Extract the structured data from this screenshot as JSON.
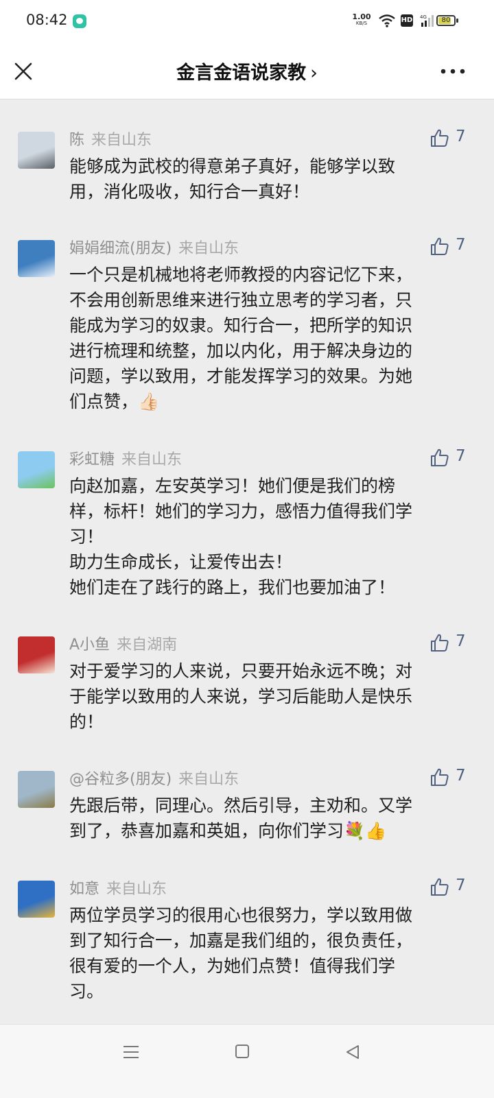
{
  "status_bar": {
    "time": "08:42",
    "net_speed": "1.00",
    "net_unit": "KB/S",
    "hd": "HD",
    "network": "4G",
    "battery": "80",
    "battery_level": 0.8
  },
  "header": {
    "title": "金言金语说家教",
    "title_chevron": "›",
    "close_icon": "close-icon",
    "more_icon": "more-dots-icon"
  },
  "comments": [
    {
      "name": "陈",
      "location": "来自山东",
      "likes": "7",
      "text": "能够成为武校的得意弟子真好，能够学以致\n用，消化吸收，知行合一真好！",
      "avatar_colors": [
        "#cfd8e0",
        "#5a5f66"
      ]
    },
    {
      "name": "娟娟细流(朋友)",
      "location": "来自山东",
      "likes": "7",
      "text": "一个只是机械地将老师教授的内容记忆下来，\n不会用创新思维来进行独立思考的学习者，只\n能成为学习的奴隶。知行合一，把所学的知识\n进行梳理和统整，加以内化，用于解决身边的\n问题，学以致用，才能发挥学习的效果。为她\n们点赞，👍🏻",
      "avatar_colors": [
        "#3f7fc0",
        "#e8f0f8"
      ]
    },
    {
      "name": "彩虹糖",
      "location": "来自山东",
      "likes": "7",
      "text": "向赵加嘉，左安英学习！她们便是我们的榜\n样，标杆！她们的学习力，感悟力值得我们学\n习！\n助力生命成长，让爱传出去！\n她们走在了践行的路上，我们也要加油了！",
      "avatar_colors": [
        "#8ecbf0",
        "#6cc35a"
      ]
    },
    {
      "name": "A小鱼",
      "location": "来自湖南",
      "likes": "7",
      "text": "对于爱学习的人来说，只要开始永远不晚；对\n于能学以致用的人来说，学习后能助人是快乐\n的！",
      "avatar_colors": [
        "#c22d2d",
        "#f4e6d6"
      ]
    },
    {
      "name": "@谷粒多(朋友)",
      "location": "来自山东",
      "likes": "7",
      "text": "先跟后带，同理心。然后引导，主劝和。又学\n到了，恭喜加嘉和英姐，向你们学习💐👍",
      "avatar_colors": [
        "#9fb7c9",
        "#8a7a45"
      ]
    },
    {
      "name": "如意",
      "location": "来自山东",
      "likes": "7",
      "text": "两位学员学习的很用心也很努力，学以致用做\n到了知行合一，加嘉是我们组的，很负责任，\n很有爱的一个人，为她们点赞！值得我们学\n习。",
      "avatar_colors": [
        "#2f6fc4",
        "#e6b53a"
      ]
    }
  ],
  "nav_bar": {
    "menu_icon": "menu-icon",
    "home_icon": "home-icon",
    "back_icon": "back-icon"
  }
}
